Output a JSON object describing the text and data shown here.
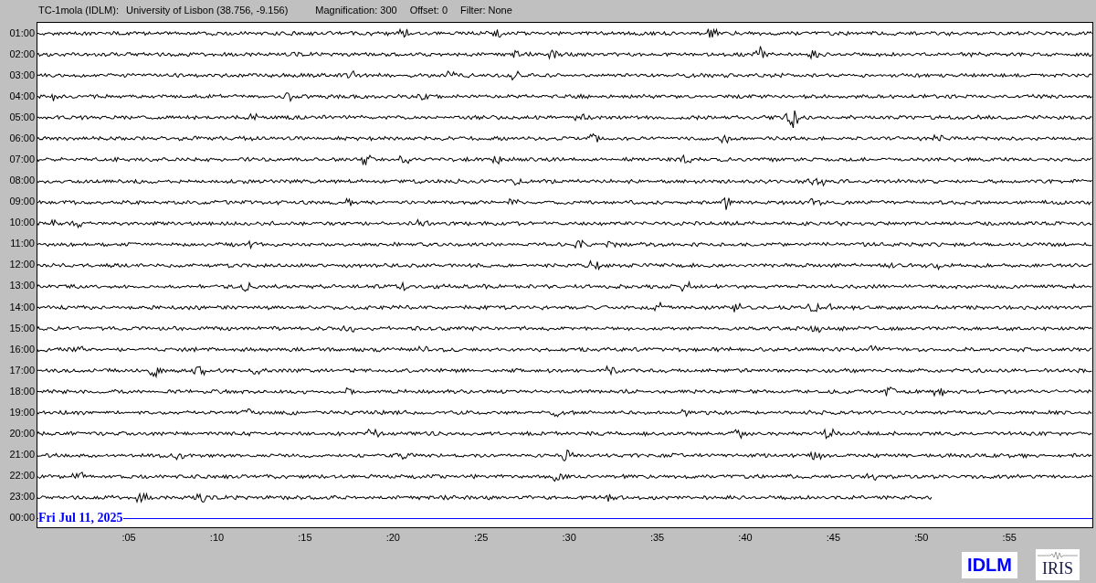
{
  "header": {
    "station": "TC-1mola (IDLM):",
    "location": "University of Lisbon (38.756, -9.156)",
    "magnification": "Magnification: 300",
    "offset": "Offset: 0",
    "filter": "Filter: None"
  },
  "rows": [
    {
      "label": "01:00",
      "kind": "full"
    },
    {
      "label": "02:00",
      "kind": "full"
    },
    {
      "label": "03:00",
      "kind": "full"
    },
    {
      "label": "04:00",
      "kind": "full"
    },
    {
      "label": "05:00",
      "kind": "full"
    },
    {
      "label": "06:00",
      "kind": "full"
    },
    {
      "label": "07:00",
      "kind": "full"
    },
    {
      "label": "08:00",
      "kind": "full"
    },
    {
      "label": "09:00",
      "kind": "full"
    },
    {
      "label": "10:00",
      "kind": "full"
    },
    {
      "label": "11:00",
      "kind": "full"
    },
    {
      "label": "12:00",
      "kind": "full"
    },
    {
      "label": "13:00",
      "kind": "full"
    },
    {
      "label": "14:00",
      "kind": "full"
    },
    {
      "label": "15:00",
      "kind": "full"
    },
    {
      "label": "16:00",
      "kind": "full"
    },
    {
      "label": "17:00",
      "kind": "full"
    },
    {
      "label": "18:00",
      "kind": "full"
    },
    {
      "label": "19:00",
      "kind": "full"
    },
    {
      "label": "20:00",
      "kind": "full"
    },
    {
      "label": "21:00",
      "kind": "full"
    },
    {
      "label": "22:00",
      "kind": "full"
    },
    {
      "label": "23:00",
      "kind": "partial"
    },
    {
      "label": "00:00",
      "kind": "marker",
      "date": "Fri Jul 11, 2025"
    }
  ],
  "x_ticks": [
    ":05",
    ":10",
    ":15",
    ":20",
    ":25",
    ":30",
    ":35",
    ":40",
    ":45",
    ":50",
    ":55"
  ],
  "logos": {
    "station": "IDLM",
    "network": "IRIS"
  }
}
